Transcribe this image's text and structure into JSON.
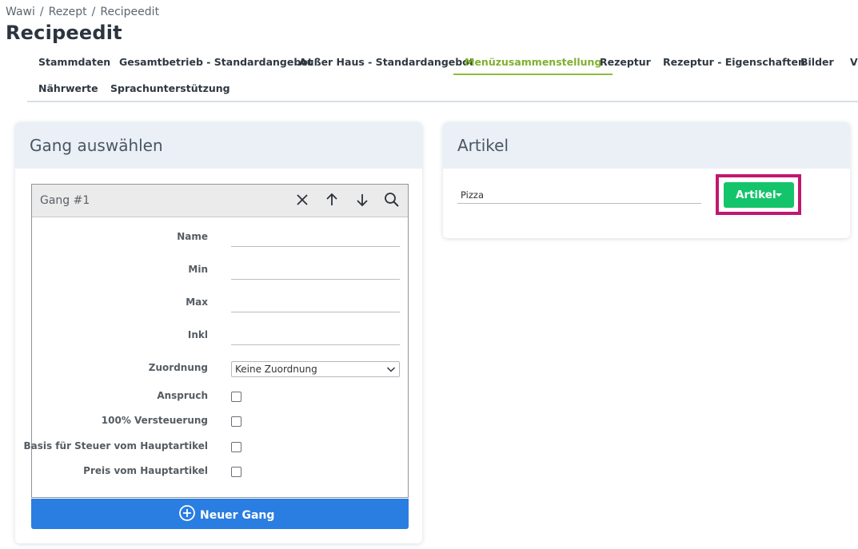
{
  "breadcrumb": [
    "Wawi",
    "Rezept",
    "Recipeedit"
  ],
  "breadcrumb_sep": "/",
  "page_title": "Recipeedit",
  "tabs": [
    {
      "label": "Stammdaten"
    },
    {
      "label": "Gesamtbetrieb - Standardangebot"
    },
    {
      "label": "Außer Haus - Standardangebot"
    },
    {
      "label": "Menüzusammenstellung",
      "active": true
    },
    {
      "label": "Rezeptur"
    },
    {
      "label": "Rezeptur - Eigenschaften"
    },
    {
      "label": "Bilder"
    },
    {
      "label": "Vi"
    },
    {
      "label": "Nährwerte"
    },
    {
      "label": "Sprachunterstützung"
    }
  ],
  "gang_panel": {
    "title": "Gang auswählen",
    "gang_title": "Gang #1",
    "icons": [
      "close-icon",
      "arrow-up-icon",
      "arrow-down-icon",
      "search-icon"
    ],
    "fields": {
      "name": {
        "label": "Name",
        "value": ""
      },
      "min": {
        "label": "Min",
        "value": ""
      },
      "max": {
        "label": "Max",
        "value": ""
      },
      "inkl": {
        "label": "Inkl",
        "value": ""
      },
      "zuordnung": {
        "label": "Zuordnung",
        "value": "Keine Zuordnung"
      },
      "anspruch": {
        "label": "Anspruch",
        "checked": false
      },
      "versteuerung": {
        "label": "100% Versteuerung",
        "checked": false
      },
      "basis": {
        "label": "Basis für Steuer vom Hauptartikel",
        "checked": false
      },
      "preis": {
        "label": "Preis vom Hauptartikel",
        "checked": false
      }
    },
    "new_button": "Neuer Gang"
  },
  "artikel_panel": {
    "title": "Artikel",
    "input_value": "Pizza",
    "button_label": "Artikel"
  },
  "colors": {
    "accent_green": "#8bbf3a",
    "button_green": "#14c46b",
    "button_blue": "#2a7de1",
    "highlight": "#c0186f",
    "panel_head": "#ebf0f7"
  }
}
